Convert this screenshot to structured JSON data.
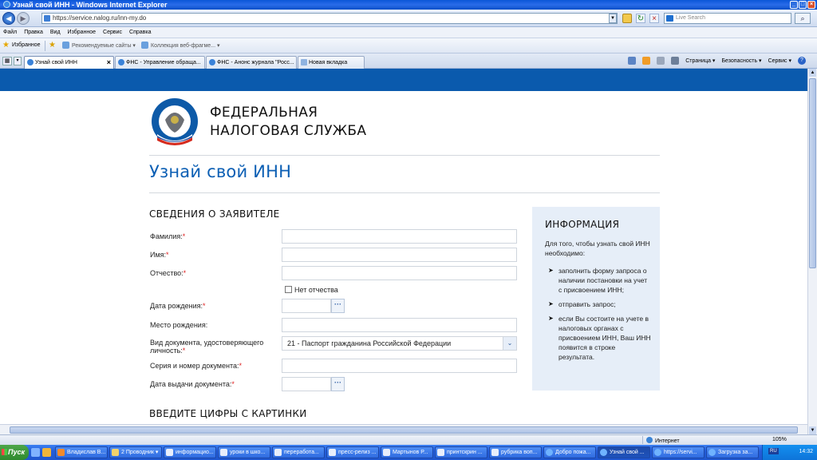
{
  "window": {
    "title": "Узнай свой ИНН - Windows Internet Explorer",
    "url": "https://service.nalog.ru/inn-my.do",
    "search_placeholder": "Live Search"
  },
  "menu": [
    "Файл",
    "Правка",
    "Вид",
    "Избранное",
    "Сервис",
    "Справка"
  ],
  "favbar": {
    "favorites": "Избранное",
    "suggested": "Рекомендуемые сайты ▾",
    "gallery": "Коллекция веб-фрагме... ▾"
  },
  "tabs": [
    {
      "label": "Узнай свой ИНН",
      "active": true
    },
    {
      "label": "ФНС - Управление обраща..."
    },
    {
      "label": "ФНС - Анонс журнала \"Росс..."
    },
    {
      "label": "Новая вкладка"
    }
  ],
  "commandbar": {
    "page": "Страница ▾",
    "safety": "Безопасность ▾",
    "tools": "Сервис ▾"
  },
  "site": {
    "org_line1": "ФЕДЕРАЛЬНАЯ",
    "org_line2": "НАЛОГОВАЯ СЛУЖБА",
    "page_title": "Узнай свой ИНН",
    "section_applicant": "СВЕДЕНИЯ О ЗАЯВИТЕЛЕ",
    "section_captcha": "ВВЕДИТЕ ЦИФРЫ С КАРТИНКИ"
  },
  "form": {
    "surname_label": "Фамилия:",
    "name_label": "Имя:",
    "patronymic_label": "Отчество:",
    "no_patronymic": "Нет отчества",
    "birth_date_label": "Дата рождения:",
    "birth_place_label": "Место рождения:",
    "doc_type_label": "Вид документа, удостоверяющего личность:",
    "doc_type_value": "21 - Паспорт гражданина Российской Федерации",
    "doc_number_label": "Серия и номер документа:",
    "doc_issue_label": "Дата выдачи документа:",
    "required_mark": "*"
  },
  "info": {
    "heading": "ИНФОРМАЦИЯ",
    "intro": "Для того, чтобы узнать свой ИНН необходимо:",
    "steps": [
      "заполнить форму запроса о наличии постановки на учет с присвоением ИНН;",
      "отправить запрос;",
      "если Вы состоите на учете в налоговых органах с присвоением ИНН, Ваш ИНН появится в строке результата."
    ]
  },
  "status": {
    "zone": "Интернет",
    "zoom": "105%"
  },
  "taskbar": {
    "start": "Пуск",
    "items": [
      "Владислав В...",
      "2 Проводник ▾",
      "информацио...",
      "уроки в шко...",
      "переработа...",
      "пресс-релиз ...",
      "Мартынов Р...",
      "принтскрин ...",
      "рубрика воп...",
      "Добро пожа...",
      "Узнай свой ...",
      "https://servi...",
      "Загрузка за..."
    ],
    "lang": "RU",
    "clock": "14:32"
  },
  "colors": {
    "brand_blue": "#0a5aad",
    "title_blue": "#0c5fb4",
    "info_bg": "#e6eef8",
    "required": "#d22222"
  }
}
